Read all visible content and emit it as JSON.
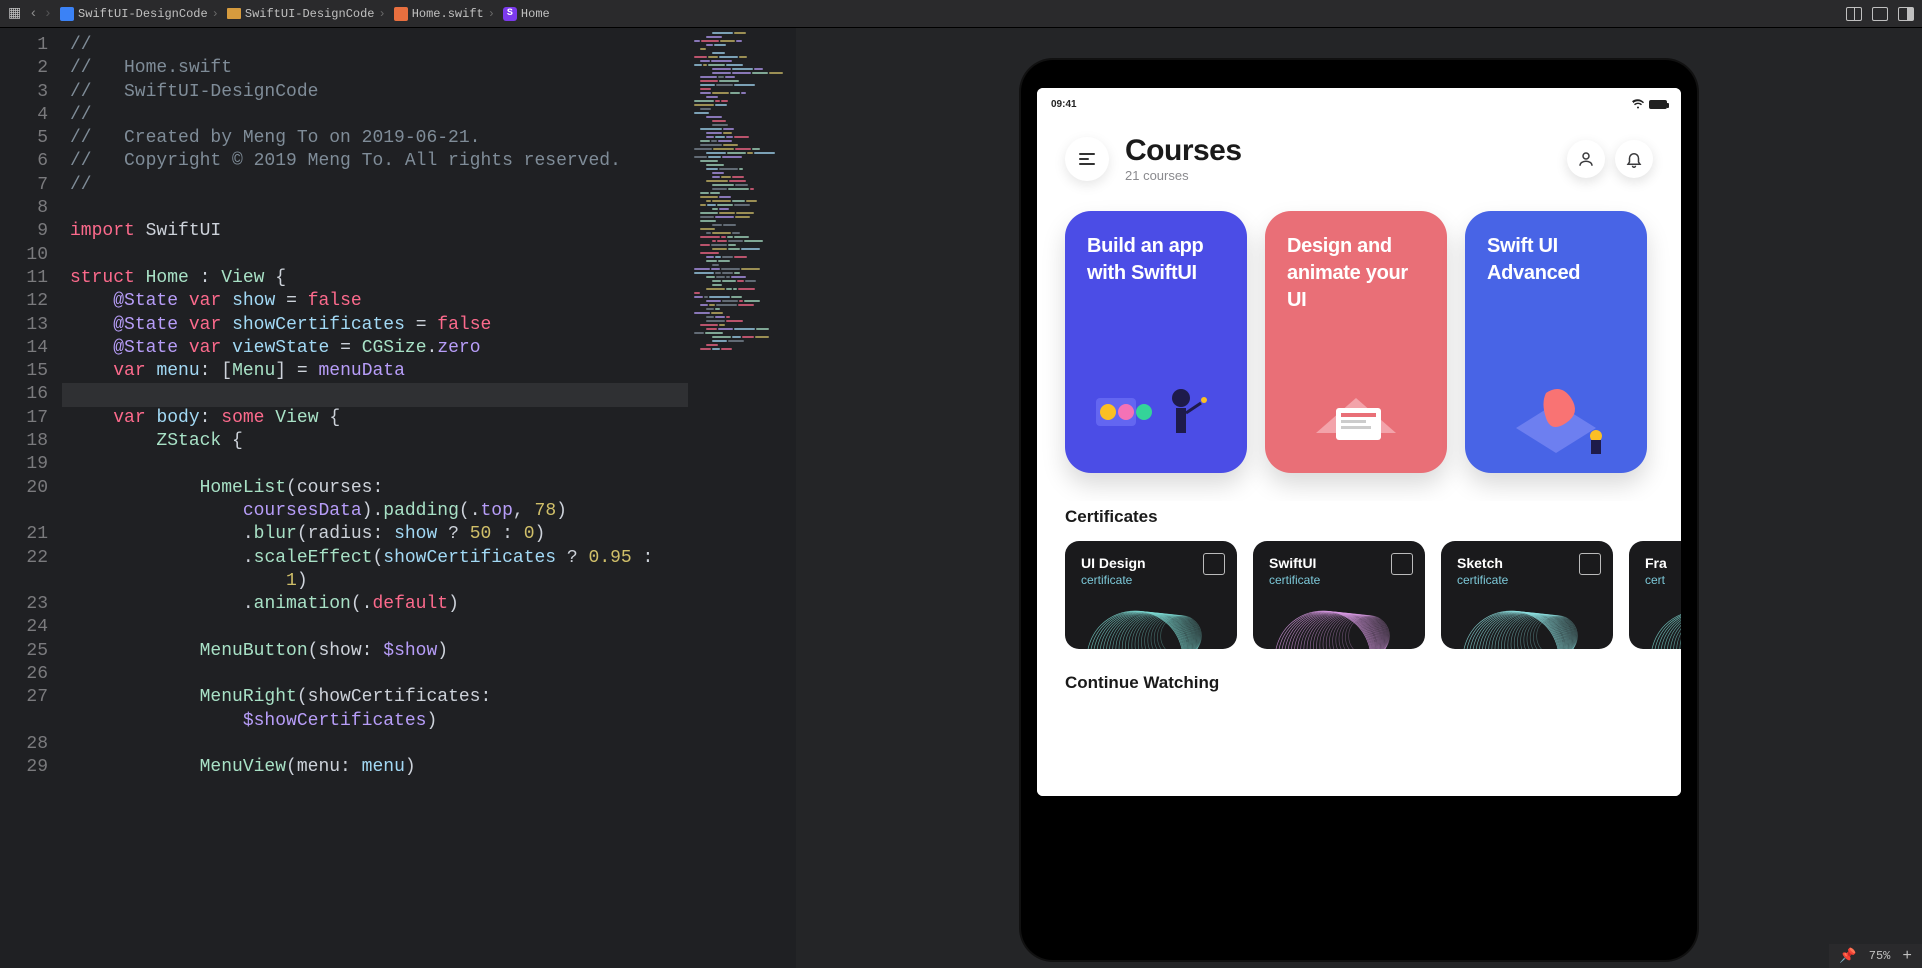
{
  "breadcrumb": {
    "items": [
      {
        "icon": "file",
        "label": "SwiftUI-DesignCode"
      },
      {
        "icon": "folder",
        "label": "SwiftUI-DesignCode"
      },
      {
        "icon": "file",
        "label": "Home.swift"
      },
      {
        "icon": "symbol",
        "label": "Home"
      }
    ]
  },
  "code": {
    "lines": [
      {
        "n": 1,
        "tokens": [
          [
            "//",
            "comment"
          ]
        ]
      },
      {
        "n": 2,
        "tokens": [
          [
            "//   Home.swift",
            "comment"
          ]
        ]
      },
      {
        "n": 3,
        "tokens": [
          [
            "//   SwiftUI-DesignCode",
            "comment"
          ]
        ]
      },
      {
        "n": 4,
        "tokens": [
          [
            "//",
            "comment"
          ]
        ]
      },
      {
        "n": 5,
        "tokens": [
          [
            "//   Created by Meng To on 2019-06-21.",
            "comment"
          ]
        ]
      },
      {
        "n": 6,
        "tokens": [
          [
            "//   Copyright © 2019 Meng To. All rights reserved.",
            "comment"
          ]
        ]
      },
      {
        "n": 7,
        "tokens": [
          [
            "//",
            "comment"
          ]
        ]
      },
      {
        "n": 8,
        "tokens": [
          [
            "",
            "op"
          ]
        ]
      },
      {
        "n": 9,
        "tokens": [
          [
            "import",
            "key"
          ],
          [
            " ",
            "op"
          ],
          [
            "SwiftUI",
            "ident"
          ]
        ]
      },
      {
        "n": 10,
        "tokens": [
          [
            "",
            "op"
          ]
        ]
      },
      {
        "n": 11,
        "tokens": [
          [
            "struct",
            "key"
          ],
          [
            " ",
            "op"
          ],
          [
            "Home",
            "type"
          ],
          [
            " : ",
            "op"
          ],
          [
            "View",
            "type"
          ],
          [
            " {",
            "op"
          ]
        ]
      },
      {
        "n": 12,
        "tokens": [
          [
            "    ",
            "op"
          ],
          [
            "@State",
            "member"
          ],
          [
            " ",
            "op"
          ],
          [
            "var",
            "key"
          ],
          [
            " ",
            "op"
          ],
          [
            "show",
            "prop"
          ],
          [
            " = ",
            "op"
          ],
          [
            "false",
            "bool"
          ]
        ]
      },
      {
        "n": 13,
        "tokens": [
          [
            "    ",
            "op"
          ],
          [
            "@State",
            "member"
          ],
          [
            " ",
            "op"
          ],
          [
            "var",
            "key"
          ],
          [
            " ",
            "op"
          ],
          [
            "showCertificates",
            "prop"
          ],
          [
            " = ",
            "op"
          ],
          [
            "false",
            "bool"
          ]
        ]
      },
      {
        "n": 14,
        "tokens": [
          [
            "    ",
            "op"
          ],
          [
            "@State",
            "member"
          ],
          [
            " ",
            "op"
          ],
          [
            "var",
            "key"
          ],
          [
            " ",
            "op"
          ],
          [
            "viewState",
            "prop"
          ],
          [
            " = ",
            "op"
          ],
          [
            "CGSize",
            "type"
          ],
          [
            ".",
            "op"
          ],
          [
            "zero",
            "member"
          ]
        ]
      },
      {
        "n": 15,
        "tokens": [
          [
            "    ",
            "op"
          ],
          [
            "var",
            "key"
          ],
          [
            " ",
            "op"
          ],
          [
            "menu",
            "prop"
          ],
          [
            ": [",
            "op"
          ],
          [
            "Menu",
            "type"
          ],
          [
            "] = ",
            "op"
          ],
          [
            "menuData",
            "member"
          ]
        ]
      },
      {
        "n": 16,
        "tokens": [
          [
            "",
            "op"
          ]
        ],
        "selected": true
      },
      {
        "n": 17,
        "tokens": [
          [
            "    ",
            "op"
          ],
          [
            "var",
            "key"
          ],
          [
            " ",
            "op"
          ],
          [
            "body",
            "prop"
          ],
          [
            ": ",
            "op"
          ],
          [
            "some",
            "key"
          ],
          [
            " ",
            "op"
          ],
          [
            "View",
            "type"
          ],
          [
            " {",
            "op"
          ]
        ]
      },
      {
        "n": 18,
        "tokens": [
          [
            "        ",
            "op"
          ],
          [
            "ZStack",
            "type"
          ],
          [
            " {",
            "op"
          ]
        ]
      },
      {
        "n": 19,
        "tokens": [
          [
            "",
            "op"
          ]
        ]
      },
      {
        "n": 20,
        "tokens": [
          [
            "            ",
            "op"
          ],
          [
            "HomeList",
            "type"
          ],
          [
            "(courses:",
            "op"
          ]
        ]
      },
      {
        "n": "",
        "tokens": [
          [
            "                ",
            "op"
          ],
          [
            "coursesData",
            "member"
          ],
          [
            ").",
            "op"
          ],
          [
            "padding",
            "func"
          ],
          [
            "(.",
            "op"
          ],
          [
            "top",
            "member"
          ],
          [
            ", ",
            "op"
          ],
          [
            "78",
            "num"
          ],
          [
            ")",
            "op"
          ]
        ]
      },
      {
        "n": 21,
        "tokens": [
          [
            "                .",
            "op"
          ],
          [
            "blur",
            "func"
          ],
          [
            "(radius: ",
            "op"
          ],
          [
            "show",
            "prop"
          ],
          [
            " ? ",
            "op"
          ],
          [
            "50",
            "num"
          ],
          [
            " : ",
            "op"
          ],
          [
            "0",
            "num"
          ],
          [
            ")",
            "op"
          ]
        ]
      },
      {
        "n": 22,
        "tokens": [
          [
            "                .",
            "op"
          ],
          [
            "scaleEffect",
            "func"
          ],
          [
            "(",
            "op"
          ],
          [
            "showCertificates",
            "prop"
          ],
          [
            " ? ",
            "op"
          ],
          [
            "0.95",
            "num"
          ],
          [
            " :",
            "op"
          ]
        ]
      },
      {
        "n": "",
        "tokens": [
          [
            "                    ",
            "op"
          ],
          [
            "1",
            "num"
          ],
          [
            ")",
            "op"
          ]
        ]
      },
      {
        "n": 23,
        "tokens": [
          [
            "                .",
            "op"
          ],
          [
            "animation",
            "func"
          ],
          [
            "(.",
            "op"
          ],
          [
            "default",
            "key"
          ],
          [
            ")",
            "op"
          ]
        ]
      },
      {
        "n": 24,
        "tokens": [
          [
            "",
            "op"
          ]
        ]
      },
      {
        "n": 25,
        "tokens": [
          [
            "            ",
            "op"
          ],
          [
            "MenuButton",
            "type"
          ],
          [
            "(show: ",
            "op"
          ],
          [
            "$show",
            "member"
          ],
          [
            ")",
            "op"
          ]
        ]
      },
      {
        "n": 26,
        "tokens": [
          [
            "",
            "op"
          ]
        ]
      },
      {
        "n": 27,
        "tokens": [
          [
            "            ",
            "op"
          ],
          [
            "MenuRight",
            "type"
          ],
          [
            "(showCertificates:",
            "op"
          ]
        ]
      },
      {
        "n": "",
        "tokens": [
          [
            "                ",
            "op"
          ],
          [
            "$showCertificates",
            "member"
          ],
          [
            ")",
            "op"
          ]
        ]
      },
      {
        "n": 28,
        "tokens": [
          [
            "",
            "op"
          ]
        ]
      },
      {
        "n": 29,
        "tokens": [
          [
            "            ",
            "op"
          ],
          [
            "MenuView",
            "type"
          ],
          [
            "(menu: ",
            "op"
          ],
          [
            "menu",
            "prop"
          ],
          [
            ")",
            "op"
          ]
        ]
      }
    ]
  },
  "preview": {
    "status_time": "09:41",
    "header_title": "Courses",
    "header_subtitle": "21 courses",
    "courses": [
      {
        "title": "Build an app with SwiftUI",
        "color": "c1"
      },
      {
        "title": "Design and animate your UI",
        "color": "c2"
      },
      {
        "title": "Swift UI Advanced",
        "color": "c3"
      }
    ],
    "certificates_heading": "Certificates",
    "certificates": [
      {
        "title": "UI Design",
        "sub": "certificate",
        "swirl": "#7cd8d1"
      },
      {
        "title": "SwiftUI",
        "sub": "certificate",
        "swirl": "#d89ae3"
      },
      {
        "title": "Sketch",
        "sub": "certificate",
        "swirl": "#8de0e0"
      },
      {
        "title": "Fra",
        "sub": "cert",
        "swirl": "#7cd8d1"
      }
    ],
    "continue_heading": "Continue Watching"
  },
  "canvas": {
    "zoom": "75%"
  }
}
